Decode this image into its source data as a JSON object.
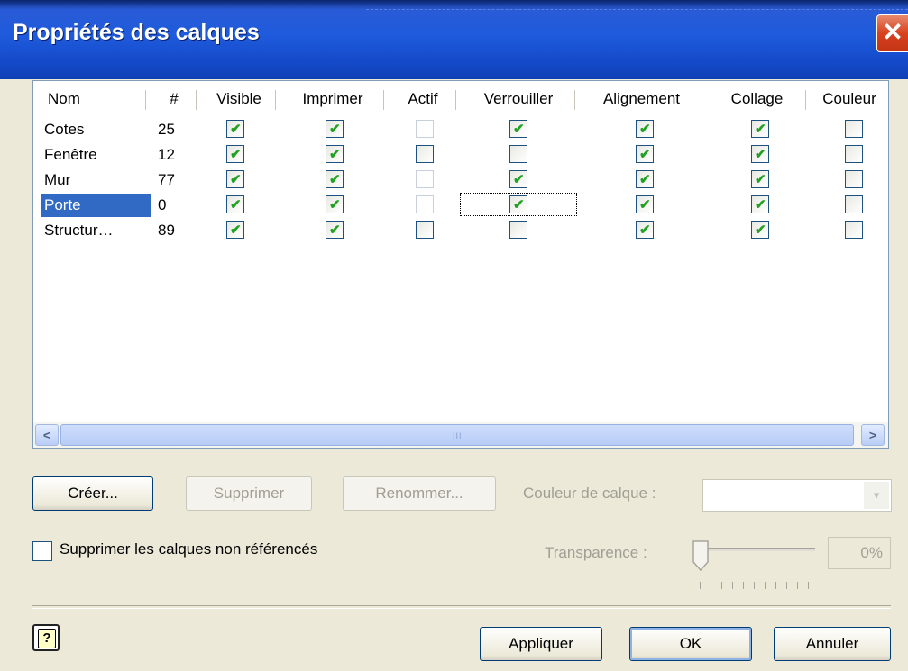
{
  "window": {
    "title": "Propriétés des calques",
    "close_icon": "close-icon"
  },
  "table": {
    "columns": [
      "Nom",
      "#",
      "Visible",
      "Imprimer",
      "Actif",
      "Verrouiller",
      "Alignement",
      "Collage",
      "Couleur"
    ],
    "rows": [
      {
        "name": "Cotes",
        "count": "25",
        "visible": true,
        "imprimer": true,
        "actif": false,
        "verrouiller": true,
        "alignement": true,
        "collage": true,
        "couleur": false
      },
      {
        "name": "Fenêtre",
        "count": "12",
        "visible": true,
        "imprimer": true,
        "actif": false,
        "verrouiller": false,
        "alignement": true,
        "collage": true,
        "couleur": false
      },
      {
        "name": "Mur",
        "count": "77",
        "visible": true,
        "imprimer": true,
        "actif": false,
        "verrouiller": true,
        "alignement": true,
        "collage": true,
        "couleur": false
      },
      {
        "name": "Porte",
        "count": "0",
        "visible": true,
        "imprimer": true,
        "actif": false,
        "verrouiller": true,
        "alignement": true,
        "collage": true,
        "couleur": false
      },
      {
        "name": "Structur…",
        "count": "89",
        "visible": true,
        "imprimer": true,
        "actif": false,
        "verrouiller": false,
        "alignement": true,
        "collage": true,
        "couleur": false
      }
    ],
    "selected_row": "Porte",
    "scroll_grip": "III"
  },
  "buttons": {
    "create": "Créer...",
    "delete": "Supprimer",
    "rename": "Renommer...",
    "apply": "Appliquer",
    "ok": "OK",
    "cancel": "Annuler"
  },
  "layer_color": {
    "label": "Couleur de calque :",
    "value": ""
  },
  "unreferenced": {
    "label": "Supprimer les calques non référencés",
    "checked": false
  },
  "transparency": {
    "label": "Transparence :",
    "value": "0%",
    "level": 0
  },
  "colors": {
    "title_bar": "#1e5bdc",
    "selection": "#316ac5",
    "checkmark": "#21a121",
    "dialog_bg": "#ece9d8"
  }
}
